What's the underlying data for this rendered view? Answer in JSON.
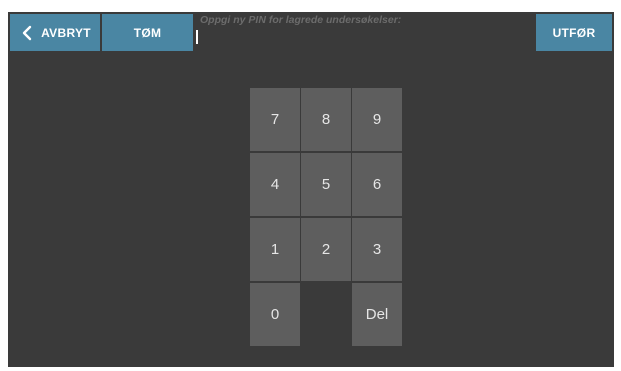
{
  "toolbar": {
    "cancel_label": "AVBRYT",
    "clear_label": "TØM",
    "execute_label": "UTFØR"
  },
  "pin_entry": {
    "prompt": "Oppgi ny PIN for lagrede undersøkelser:",
    "value": ""
  },
  "keypad": {
    "keys": [
      "7",
      "8",
      "9",
      "4",
      "5",
      "6",
      "1",
      "2",
      "3",
      "0",
      "Del"
    ]
  },
  "colors": {
    "background": "#3a3a3a",
    "button": "#4a86a3",
    "key": "#5e5e5e",
    "prompt_text": "#6b6b6b"
  },
  "icons": {
    "back": "chevron-left-icon"
  }
}
